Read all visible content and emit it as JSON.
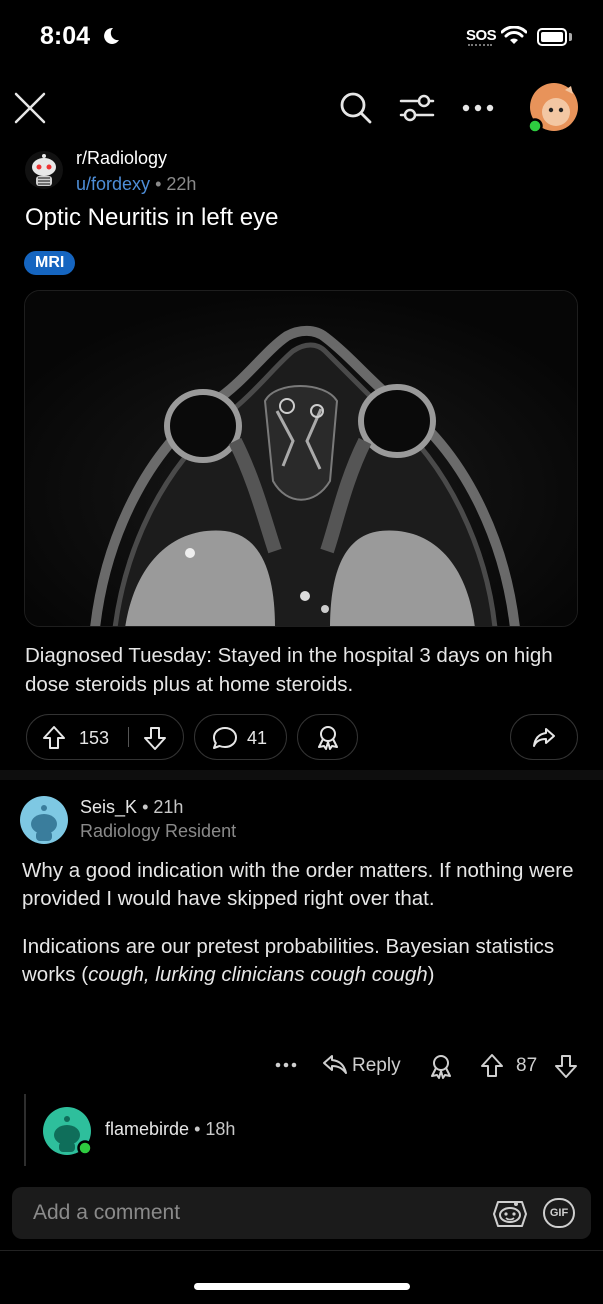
{
  "status_bar": {
    "time": "8:04",
    "sos": "SOS",
    "icons": [
      "moon-icon",
      "wifi-icon",
      "battery-icon"
    ]
  },
  "nav": {
    "icons": [
      "close-icon",
      "search-icon",
      "filter-icon",
      "more-icon",
      "avatar"
    ]
  },
  "post": {
    "subreddit": "r/Radiology",
    "author": "u/fordexy",
    "separator": "•",
    "age": "22h",
    "title": "Optic Neuritis in left eye",
    "flair": "MRI",
    "flair_color": "#1565c0",
    "body": "Diagnosed Tuesday: Stayed in the hospital 3 days on high dose steroids plus at home steroids.",
    "score": "153",
    "comments": "41"
  },
  "comment": {
    "author": "Seis_K",
    "separator": "•",
    "age": "21h",
    "flair": "Radiology Resident",
    "paragraph1": "Why a good indication with the order matters. If nothing were provided I would have skipped right over that.",
    "paragraph2_start": "Indications are our pretest probabilities. Bayesian statistics works (",
    "paragraph2_italic": "cough, lurking clinicians cough cough",
    "paragraph2_end": ")",
    "more": "•••",
    "reply_label": "Reply",
    "score": "87"
  },
  "reply": {
    "author": "flamebirde",
    "separator": "•",
    "age": "18h"
  },
  "composer": {
    "placeholder": "Add a comment",
    "gif_label": "GIF"
  },
  "colors": {
    "background": "#000000",
    "link": "#4e8ed8",
    "online": "#2ecc40"
  }
}
